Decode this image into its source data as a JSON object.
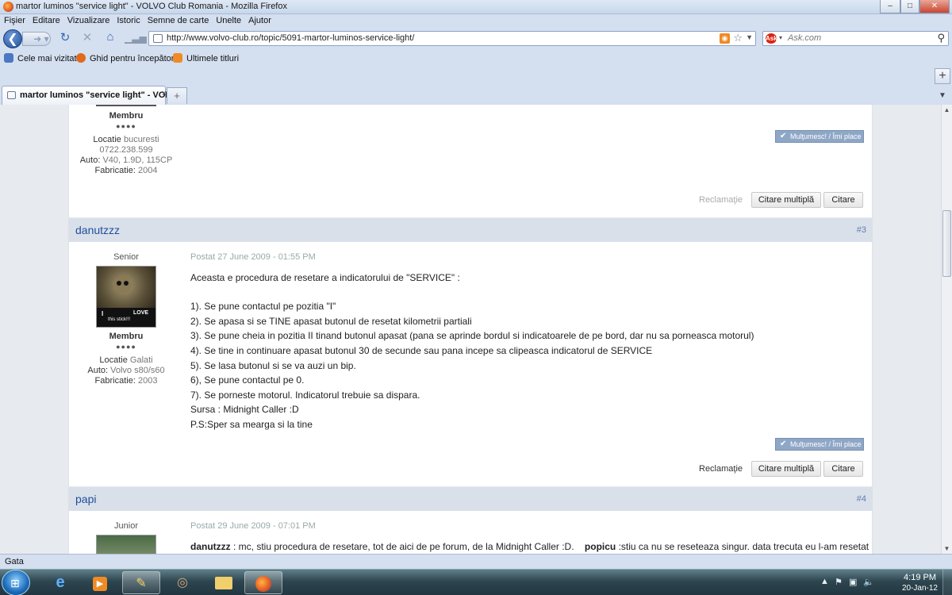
{
  "window": {
    "title": "martor luminos \"service light\" - VOLVO Club Romania - Mozilla Firefox",
    "min": "–",
    "max": "□",
    "close": "✕"
  },
  "menu": [
    "Fişier",
    "Editare",
    "Vizualizare",
    "Istoric",
    "Semne de carte",
    "Unelte",
    "Ajutor"
  ],
  "nav": {
    "url": "http://www.volvo-club.ro/topic/5091-martor-luminos-service-light/",
    "search_placeholder": "Ask.com",
    "search_engine_badge": "Ask"
  },
  "bookmarks": [
    {
      "label": "Cele mai vizitate",
      "color": "#4a78c2"
    },
    {
      "label": "Ghid pentru începători",
      "color": "#e06a1b"
    },
    {
      "label": "Ultimele titluri",
      "color": "#f08a24"
    }
  ],
  "tab": {
    "label": "martor luminos \"service light\" - VOL...",
    "close": "×",
    "new": "+"
  },
  "posts": {
    "top": {
      "member_label": "Membru",
      "pips": "●●●●",
      "location_label": "Locatie",
      "location": "bucuresti",
      "phone": "0722.238.599",
      "auto_label": "Auto:",
      "auto": "V40, 1.9D, 115CP",
      "fab_label": "Fabricatie:",
      "fab": "2004",
      "thanks": "Mulţumesc! / Îmi place",
      "report": "Reclamaţie",
      "multiquote": "Citare multiplă",
      "quote": "Citare"
    },
    "p3": {
      "author": "danutzzz",
      "num": "#3",
      "rank": "Senior",
      "member_label": "Membru",
      "pips": "●●●●",
      "location_label": "Locatie",
      "location": "Galati",
      "auto_label": "Auto:",
      "auto": "Volvo s80/s60",
      "fab_label": "Fabricatie:",
      "fab": "2003",
      "date": "Postat 27 June 2009 - 01:55 PM",
      "lines": [
        "Aceasta e procedura de resetare a indicatorului de \"SERVICE\" :",
        "1). Se pune contactul pe pozitia \"I\"",
        "2). Se apasa si se TINE apasat butonul de resetat kilometrii partiali",
        "3). Se pune cheia in pozitia II tinand butonul apasat (pana se aprinde bordul si indicatoarele de pe bord, dar nu sa porneasca motorul)",
        "4). Se tine in continuare apasat butonul 30 de secunde sau pana incepe sa clipeasca indicatorul de SERVICE",
        "5). Se lasa butonul si se va auzi un bip.",
        "6), Se pune contactul pe 0.",
        "7). Se porneste motorul. Indicatorul trebuie sa dispara.",
        "Sursa : Midnight Caller :D",
        "P.S:Sper sa mearga si la tine"
      ],
      "avatar_text1": "I",
      "avatar_text2": "LOVE",
      "avatar_text3": "this stick!!!",
      "thanks": "Mulţumesc! / Îmi place",
      "report": "Reclamaţie",
      "multiquote": "Citare multiplă",
      "quote": "Citare"
    },
    "p4": {
      "author": "papi",
      "num": "#4",
      "rank": "Junior",
      "date": "Postat 29 June 2009 - 07:01 PM",
      "name1": "danutzzz",
      "text1": ": mc, stiu procedura de resetare, tot de aici de pe forum, de la Midnight Caller  :D.",
      "name2": "popicu",
      "text2": ":stiu ca nu se reseteaza singur. data trecuta eu l-am resetat"
    }
  },
  "status": "Gata",
  "taskbar": {
    "time": "4:19 PM",
    "date": "20-Jan-12"
  }
}
